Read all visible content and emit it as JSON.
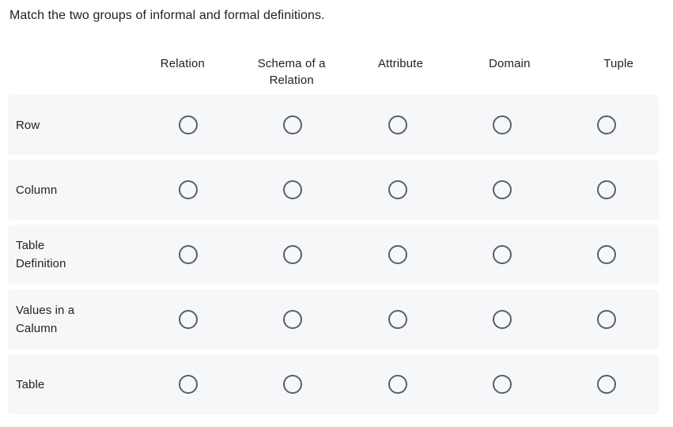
{
  "question": {
    "prompt": "Match the two groups of informal and formal definitions."
  },
  "matrix": {
    "columns": [
      {
        "id": "relation",
        "label": "Relation",
        "lines": [
          "Relation"
        ]
      },
      {
        "id": "schema-of-a-relation",
        "label": "Schema of a Relation",
        "lines": [
          "Schema of a",
          "Relation"
        ]
      },
      {
        "id": "attribute",
        "label": "Attribute",
        "lines": [
          "Attribute"
        ]
      },
      {
        "id": "domain",
        "label": "Domain",
        "lines": [
          "Domain"
        ]
      },
      {
        "id": "tuple",
        "label": "Tuple",
        "lines": [
          "Tuple"
        ]
      }
    ],
    "rows": [
      {
        "id": "row",
        "label": "Row",
        "lines": [
          "Row"
        ],
        "selected": null
      },
      {
        "id": "column",
        "label": "Column",
        "lines": [
          "Column"
        ],
        "selected": null
      },
      {
        "id": "table-definition",
        "label": "Table Definition",
        "lines": [
          "Table",
          "Definition"
        ],
        "selected": null
      },
      {
        "id": "values-in-a-calumn",
        "label": "Values in a Calumn",
        "lines": [
          "Values in a",
          "Calumn"
        ],
        "selected": null
      },
      {
        "id": "table",
        "label": "Table",
        "lines": [
          "Table"
        ],
        "selected": null
      }
    ]
  },
  "style": {
    "row_background": "#f6f7f9",
    "page_background": "#ffffff",
    "text_color": "#1f2023",
    "radio_border_color": "#5a5f66"
  }
}
